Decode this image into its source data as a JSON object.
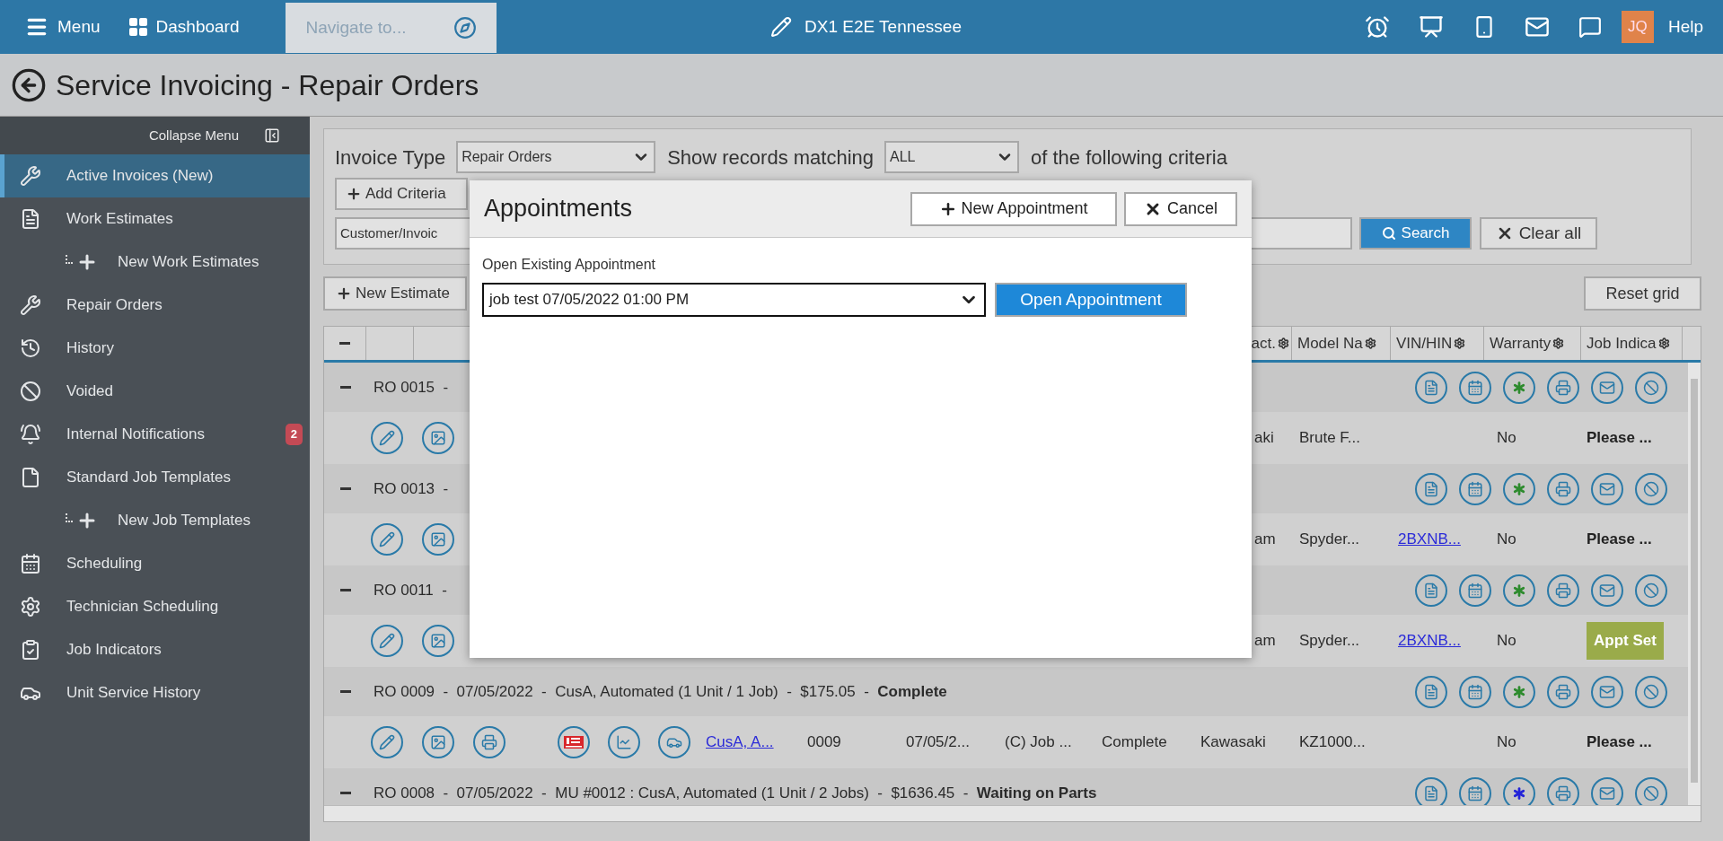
{
  "top_bar": {
    "menu": "Menu",
    "dashboard": "Dashboard",
    "navigate": {
      "placeholder": "Navigate to..."
    },
    "site": "DX1 E2E Tennessee",
    "avatar": "JQ",
    "help": "Help"
  },
  "page": {
    "title": "Service Invoicing - Repair Orders"
  },
  "sidebar": {
    "collapse": "Collapse Menu",
    "items": [
      {
        "label": "Active Invoices (New)",
        "selected": true
      },
      {
        "label": "Work Estimates",
        "selected": false,
        "children": [
          {
            "label": "New Work Estimates",
            "selected": false
          }
        ]
      },
      {
        "label": "Repair Orders",
        "selected": false
      },
      {
        "label": "History",
        "selected": false
      },
      {
        "label": "Voided",
        "selected": false
      },
      {
        "label": "Internal Notifications",
        "selected": false,
        "badge": "2"
      },
      {
        "label": "Standard Job Templates",
        "selected": false,
        "children": [
          {
            "label": "New Job Templates",
            "selected": false
          }
        ]
      },
      {
        "label": "Scheduling",
        "selected": false
      },
      {
        "label": "Technician Scheduling",
        "selected": false
      },
      {
        "label": "Job Indicators",
        "selected": false
      },
      {
        "label": "Unit Service History",
        "selected": false
      }
    ]
  },
  "filters": {
    "invoice_type_label": "Invoice Type",
    "invoice_type": "Repair Orders",
    "matching_label": "Show records matching",
    "matching": "ALL",
    "criteria_label": "of the following criteria",
    "add_criteria": "Add Criteria",
    "criteria_field": "Customer/Invoic",
    "search": "Search",
    "clear": "Clear all"
  },
  "toolbar": {
    "new_estimate": "New Estimate",
    "reset": "Reset grid"
  },
  "grid": {
    "columns": [
      {
        "label": "act."
      },
      {
        "label": "Model Na"
      },
      {
        "label": "VIN/HIN"
      },
      {
        "label": "Warranty"
      },
      {
        "label": "Job Indica"
      }
    ],
    "rows": [
      {
        "kind": "group",
        "text": "RO 0015  -",
        "color": "#2e8b2e"
      },
      {
        "kind": "detail_partial",
        "make": "aki",
        "model": "Brute F...",
        "warranty": "No",
        "job_indicator": {
          "text": "Please ...",
          "badge": false
        }
      },
      {
        "kind": "group",
        "text": "RO 0013  -",
        "color": "#2e8b2e"
      },
      {
        "kind": "detail_partial",
        "make": "am",
        "model": "Spyder...",
        "vin_hin": "2BXNB...",
        "warranty": "No",
        "job_indicator": {
          "text": "Please ...",
          "badge": false
        }
      },
      {
        "kind": "group",
        "text": "RO 0011  -",
        "color": "#2e8b2e"
      },
      {
        "kind": "detail_partial",
        "make": "am",
        "model": "Spyder...",
        "vin_hin": "2BXNB...",
        "warranty": "No",
        "job_indicator": {
          "text": "Appt Set",
          "badge": true
        }
      },
      {
        "kind": "group",
        "text": "RO 0009  -  07/05/2022  -  CusA, Automated (1 Unit / 1 Job)  -  $175.05  -  **Complete**",
        "color": "#2e8b2e"
      },
      {
        "kind": "detail",
        "customer": "CusA, A...",
        "ro_number": "0009",
        "date": "07/05/2...",
        "job": "(C) Job ...",
        "status": "Complete",
        "make": "Kawasaki",
        "model": "KZ1000...",
        "warranty": "No",
        "job_indicator": {
          "text": "Please ...",
          "badge": false
        }
      },
      {
        "kind": "group",
        "text": "RO 0008  -  07/05/2022  -  MU #0012 : CusA, Automated (1 Unit / 2 Jobs)  -  $1636.45  -  **Waiting on Parts**",
        "color": "#2424d8"
      }
    ]
  },
  "dialog": {
    "title": "Appointments",
    "new_button": "New Appointment",
    "cancel_button": "Cancel",
    "existing_label": "Open Existing Appointment",
    "appointment": "job test 07/05/2022 01:00 PM",
    "open_button": "Open Appointment"
  }
}
